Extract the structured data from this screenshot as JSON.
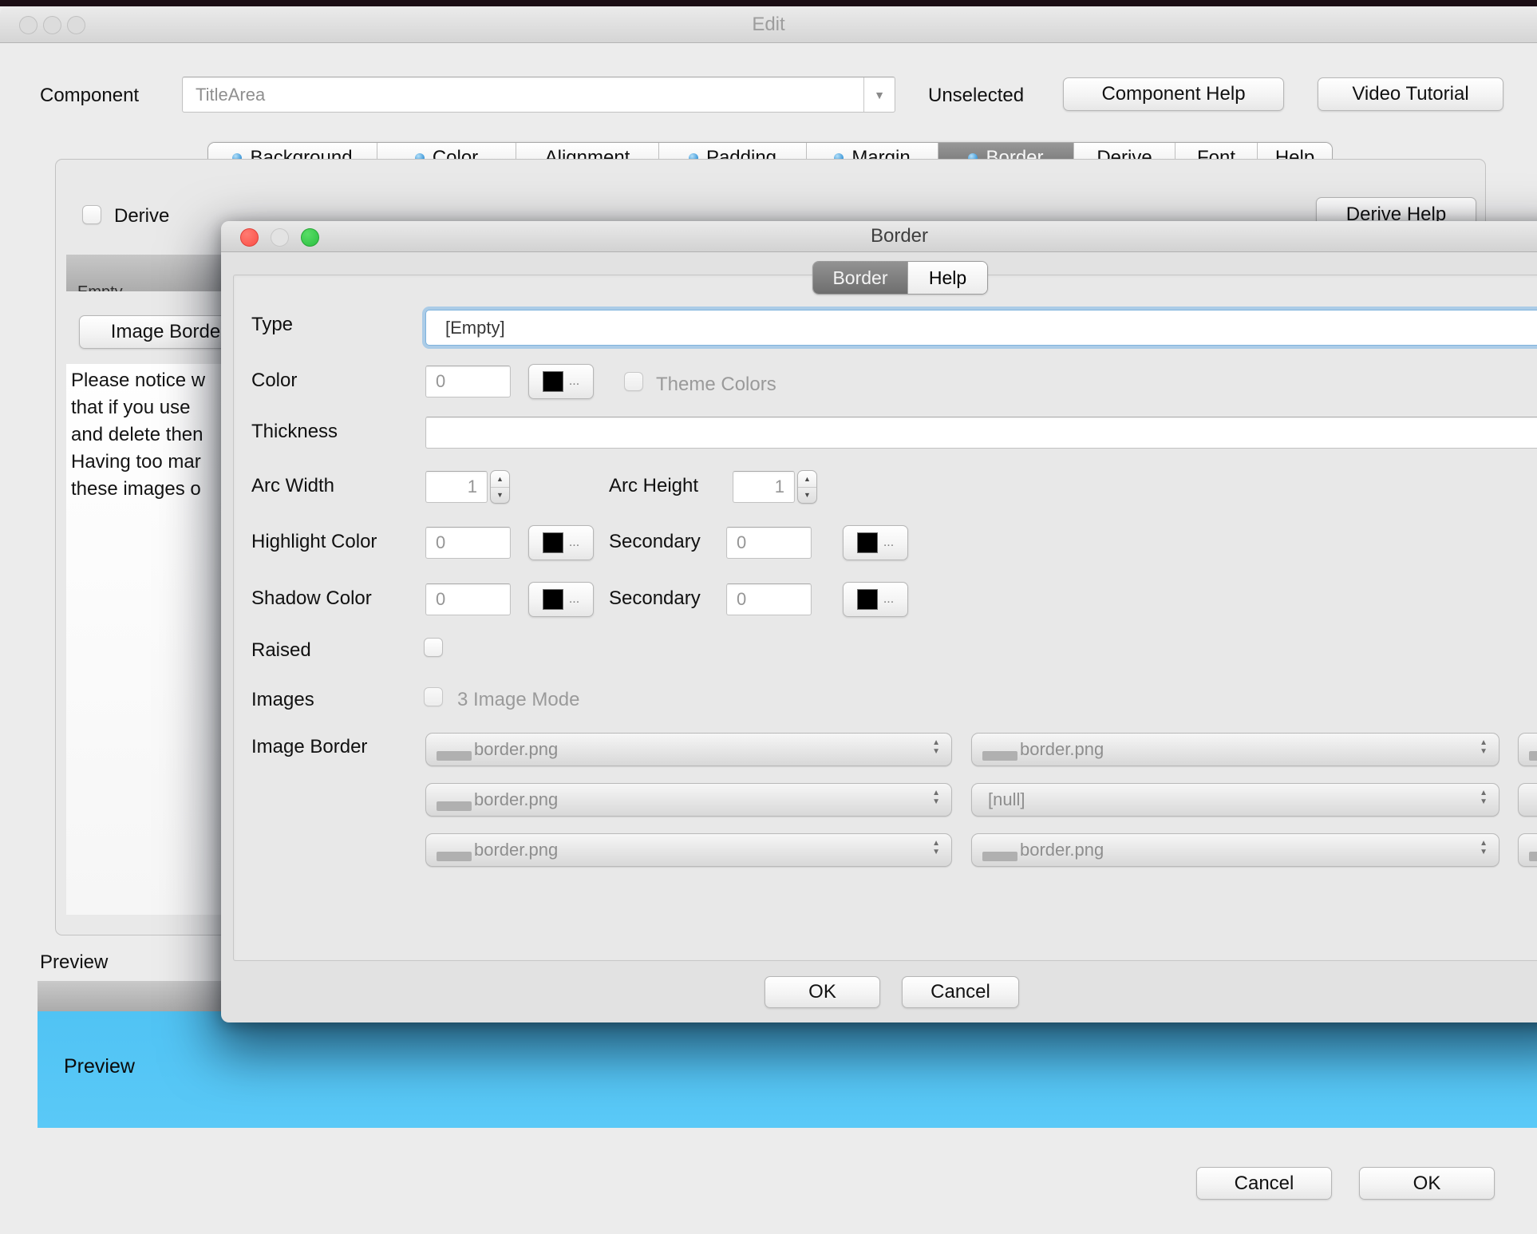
{
  "edit_window": {
    "title": "Edit",
    "component_label": "Component",
    "component_value": "TitleArea",
    "unselected_label": "Unselected",
    "component_help_button": "Component Help",
    "video_tutorial_button": "Video Tutorial",
    "tabs": [
      {
        "label": "Background",
        "modified": true,
        "selected": false
      },
      {
        "label": "Color",
        "modified": true,
        "selected": false
      },
      {
        "label": "Alignment",
        "modified": false,
        "selected": false
      },
      {
        "label": "Padding",
        "modified": true,
        "selected": false
      },
      {
        "label": "Margin",
        "modified": true,
        "selected": false
      },
      {
        "label": "Border",
        "modified": true,
        "selected": true
      },
      {
        "label": "Derive",
        "modified": false,
        "selected": false
      },
      {
        "label": "Font",
        "modified": false,
        "selected": false
      },
      {
        "label": "Help",
        "modified": false,
        "selected": false
      }
    ],
    "panel": {
      "derive_checkbox_label": "Derive",
      "clipped_item_text": "Empty",
      "image_border_button": "Image Border",
      "notice_lines": [
        "Please notice w",
        "that if you use ",
        "and delete then",
        "Having too mar",
        "these images o"
      ]
    },
    "derive_help_button": "Derive Help",
    "preview_label": "Preview",
    "preview_content_text": "Preview",
    "footer": {
      "cancel_button": "Cancel",
      "ok_button": "OK"
    }
  },
  "border_dialog": {
    "title": "Border",
    "tabs": [
      {
        "label": "Border",
        "selected": true
      },
      {
        "label": "Help",
        "selected": false
      }
    ],
    "form": {
      "type_label": "Type",
      "type_value": "[Empty]",
      "color_label": "Color",
      "color_value": "0",
      "more_button": "...",
      "theme_colors_label": "Theme Colors",
      "thickness_label": "Thickness",
      "thickness_value": "",
      "arc_width_label": "Arc Width",
      "arc_width_value": "1",
      "arc_height_label": "Arc Height",
      "arc_height_value": "1",
      "highlight_color_label": "Highlight Color",
      "highlight_color_value": "0",
      "highlight_secondary_label": "Secondary",
      "highlight_secondary_value": "0",
      "shadow_color_label": "Shadow Color",
      "shadow_color_value": "0",
      "shadow_secondary_label": "Secondary",
      "shadow_secondary_value": "0",
      "raised_label": "Raised",
      "images_label": "Images",
      "image_mode_label": "3 Image Mode",
      "image_border_label": "Image Border",
      "image_border_rows": [
        {
          "col1": "border.png",
          "col2": "border.png"
        },
        {
          "col1": "border.png",
          "col2": "[null]"
        },
        {
          "col1": "border.png",
          "col2": "border.png"
        }
      ]
    },
    "ok_button": "OK",
    "cancel_button": "Cancel"
  },
  "colors": {
    "accent_focus_ring": "#7db5e3",
    "tab_modified_dot": "#4aa0dd",
    "preview_blue": "#54c5f5",
    "selected_tab_gray": "#7a7a7a",
    "traffic_close": "#fc5b57",
    "traffic_zoom": "#34c84a"
  }
}
